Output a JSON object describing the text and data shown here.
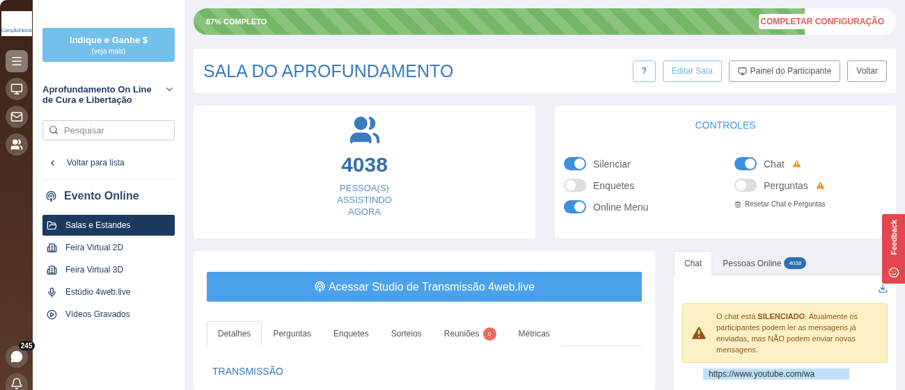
{
  "rail": {
    "logo": "CançãoNova",
    "items": [
      {
        "kind": "menu",
        "selected": true
      },
      {
        "kind": "monitor",
        "selected": false
      },
      {
        "kind": "mail",
        "selected": false
      },
      {
        "kind": "users",
        "selected": false
      }
    ],
    "chat_badge": "245"
  },
  "sidebar": {
    "promo": {
      "title": "Indique e Ganhe $",
      "subtitle": "(veja mais)"
    },
    "event_title": "Aprofundamento On Line de Cura e Libertação",
    "search": {
      "placeholder": "Pesquisar"
    },
    "back": "Voltar para lista",
    "section": "Evento Online",
    "items": [
      {
        "label": "Salas e Estandes",
        "kind": "folder",
        "selected": true
      },
      {
        "label": "Feira Virtual 2D",
        "kind": "building",
        "selected": false
      },
      {
        "label": "Feira Virtual 3D",
        "kind": "building",
        "selected": false
      },
      {
        "label": "Estúdio 4web.live",
        "kind": "mic",
        "selected": false
      },
      {
        "label": "Vídeos Gravados",
        "kind": "play",
        "selected": false
      }
    ]
  },
  "progress": {
    "label": "87% COMPLETO",
    "level": 0.87,
    "action": "COMPLETAR CONFIGURAÇÃO"
  },
  "header": {
    "title": "SALA DO APROFUNDAMENTO",
    "buttons": [
      {
        "label": "?",
        "kind": "help"
      },
      {
        "label": "Editar Sala",
        "kind": "primary"
      },
      {
        "label": "Painel do Participante",
        "kind": "monitor"
      },
      {
        "label": "Voltar",
        "kind": "plain"
      }
    ]
  },
  "stats": {
    "count": "4038",
    "caption": "PESSOA(S) ASSISTINDO AGORA"
  },
  "controls": {
    "title": "CONTROLES",
    "left": [
      {
        "label": "Silenciar",
        "on": true,
        "warning": false
      },
      {
        "label": "Enquetes",
        "on": false,
        "warning": false
      },
      {
        "label": "Online Menu",
        "on": true,
        "warning": false
      }
    ],
    "right": [
      {
        "label": "Chat",
        "on": true,
        "warning": true
      },
      {
        "label": "Perguntas",
        "on": false,
        "warning": true
      }
    ],
    "reset": "Resetar Chat e Perguntas"
  },
  "studio_button": "Acessar Studio de Transmissão 4web.live",
  "tabs": [
    {
      "label": "Detalhes",
      "selected": true
    },
    {
      "label": "Perguntas",
      "selected": false
    },
    {
      "label": "Enquetes",
      "selected": false
    },
    {
      "label": "Sorteios",
      "selected": false
    },
    {
      "label": "Reuniões",
      "selected": false,
      "badge": "0"
    },
    {
      "label": "Métricas",
      "selected": false
    }
  ],
  "section_title": "TRANSMISSÃO",
  "chat": {
    "tabs": [
      {
        "label": "Chat",
        "selected": true
      },
      {
        "label": "Pessoas Online",
        "selected": false,
        "badge": "4038"
      }
    ],
    "alert": "O chat está **SILENCIADO**. Atualmente os participantes podem ler as mensagens já enviadas, mas NÃO podem enviar novas mensagens.",
    "url": "https://www.youtube.com/wa"
  },
  "feedback": "Feedback"
}
